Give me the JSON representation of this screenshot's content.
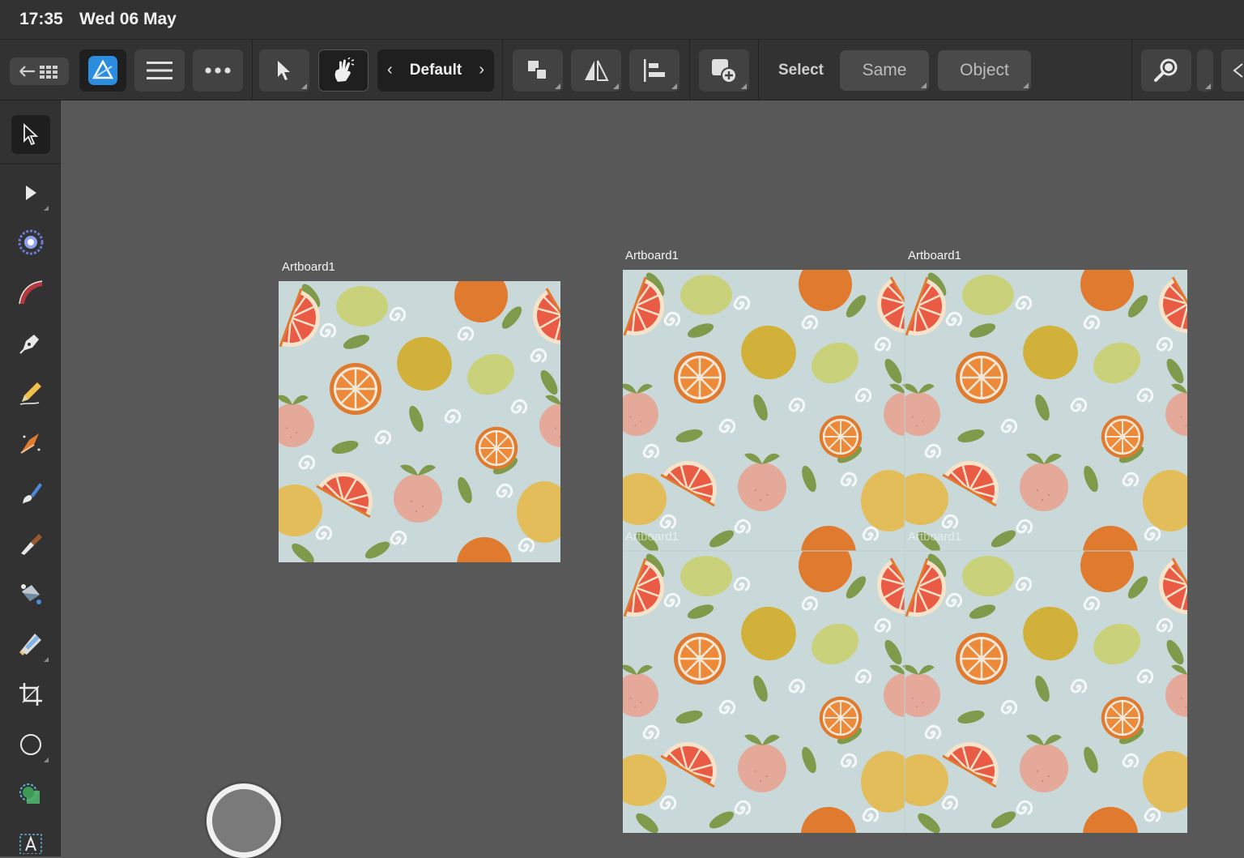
{
  "status_bar": {
    "time": "17:35",
    "date": "Wed 06 May"
  },
  "toolbar": {
    "persona": "Default",
    "select_label": "Select",
    "same_label": "Same",
    "object_label": "Object"
  },
  "tools": [
    "move-tool-icon",
    "node-tool-icon",
    "corner-tool-icon",
    "pencil-arc-icon",
    "pen-tool-icon",
    "pencil-tool-icon",
    "vector-brush-icon",
    "paint-brush-icon",
    "knife-icon",
    "fill-tool-icon",
    "transparency-tool-icon",
    "crop-icon",
    "ellipse-icon",
    "shape-builder-icon",
    "artistic-text-icon"
  ],
  "canvas": {
    "artboards": [
      {
        "label": "Artboard1"
      },
      {
        "label": "Artboard1"
      },
      {
        "label": "Artboard1"
      },
      {
        "label": "Artboard1"
      },
      {
        "label": "Artboard1"
      }
    ]
  },
  "colors": {
    "canvas_bg": "#585858",
    "pattern_bg": "#c9d9d9",
    "orange": "#e07a2e",
    "lemon": "#d1b13a",
    "lime": "#c9d27a",
    "leaf": "#7f9a4a",
    "peach": "#e5a99a",
    "grapefruit": "#ea5b45"
  }
}
